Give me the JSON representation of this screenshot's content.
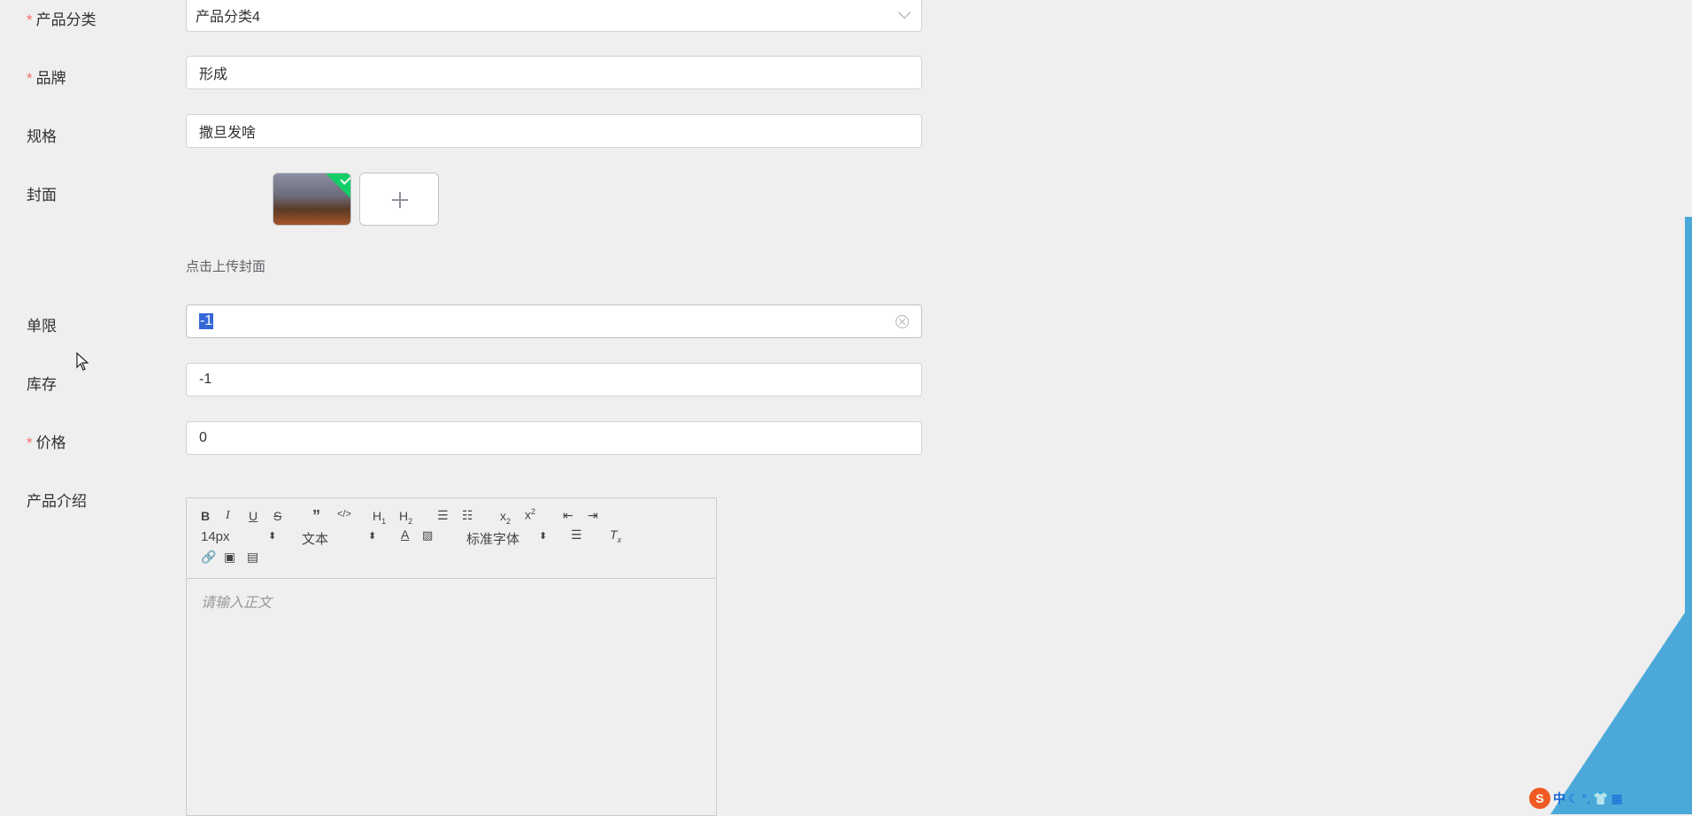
{
  "form": {
    "category": {
      "label": "产品分类",
      "value": "产品分类4"
    },
    "brand": {
      "label": "品牌",
      "value": "形成"
    },
    "spec": {
      "label": "规格",
      "value": "撒旦发啥"
    },
    "cover": {
      "label": "封面",
      "tip": "点击上传封面"
    },
    "limit": {
      "label": "单限",
      "value": "-1"
    },
    "stock": {
      "label": "库存",
      "value": "-1"
    },
    "price": {
      "label": "价格",
      "value": "0"
    },
    "intro": {
      "label": "产品介绍"
    }
  },
  "editor": {
    "size_select": "14px",
    "heading_select": "文本",
    "font_select": "标准字体",
    "placeholder": "请输入正文"
  },
  "ime": {
    "lang": "中",
    "logo": "S"
  },
  "colors": {
    "required": "#f56c6c",
    "success": "#13ce66",
    "accent": "#4aa9d9"
  }
}
